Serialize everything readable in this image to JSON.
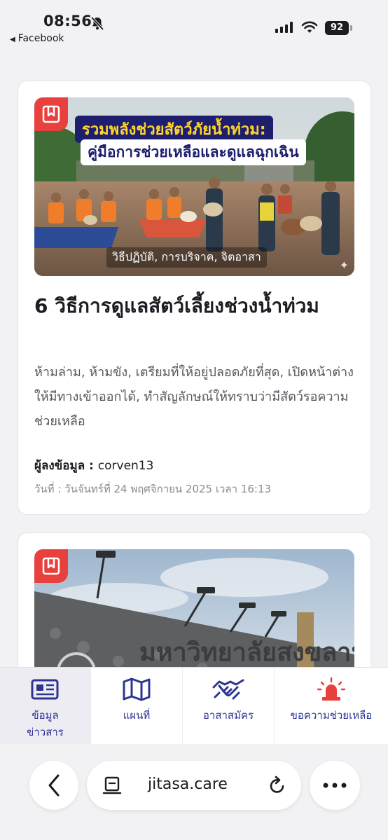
{
  "status_bar": {
    "time": "08:56",
    "back_app": "Facebook",
    "battery": "92"
  },
  "articles": [
    {
      "image_banner_line1": "รวมพลังช่วยสัตว์ภัยน้ำท่วม:",
      "image_banner_line2": "คู่มือการช่วยเหลือและดูแลฉุกเฉิน",
      "image_caption": "วิธีปฏิบัติ, การบริจาค, จิตอาสา",
      "title": "6 วิธีการดูแลสัตว์เลี้ยงช่วงน้ำท่วม",
      "summary": "ห้ามล่าม, ห้ามขัง, เตรียมที่ให้อยู่ปลอดภัยที่สุด, เปิดหน้าต่างให้มีทางเข้าออกได้, ทำสัญลักษณ์ให้ทราบว่ามีสัตว์รอความช่วยเหลือ",
      "author_label": "ผู้ลงข้อมูล : ",
      "author": "corven13",
      "date": "วันที่ : วันจันทร์ที่ 24 พฤศจิกายน 2025 เวลา 16:13"
    },
    {
      "image_sign_text": "มหาวิทยาลัยสงขลานครินทร์"
    }
  ],
  "tabbar": {
    "tabs": [
      {
        "label": "ข้อมูล\nข่าวสาร",
        "icon": "newspaper-icon",
        "active": true
      },
      {
        "label": "แผนที่",
        "icon": "map-icon",
        "active": false
      },
      {
        "label": "อาสาสมัคร",
        "icon": "handshake-icon",
        "active": false
      },
      {
        "label": "ขอความช่วยเหลือ",
        "icon": "siren-icon",
        "active": false
      }
    ],
    "accent": "#2d3593",
    "alert_color": "#e8403d"
  },
  "browser": {
    "url": "jitasa.care"
  }
}
